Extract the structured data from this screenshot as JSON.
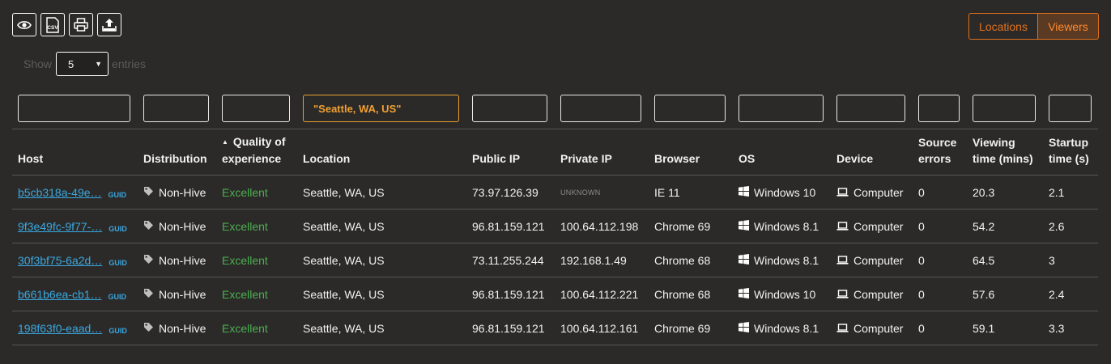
{
  "toolbar": {
    "view_icon": "eye-icon",
    "csv_icon": "csv-icon",
    "csv_label": "CSV",
    "print_icon": "printer-icon",
    "export_icon": "upload-icon"
  },
  "tabs": {
    "locations": "Locations",
    "viewers": "Viewers",
    "active": "Viewers"
  },
  "length": {
    "show": "Show",
    "value": "5",
    "entries": "entries"
  },
  "filters": {
    "host": "",
    "distribution": "",
    "quality": "",
    "location": "\"Seattle, WA, US\"",
    "public_ip": "",
    "private_ip": "",
    "browser": "",
    "os": "",
    "device": "",
    "source_errors": "",
    "viewing_time": "",
    "startup_time": ""
  },
  "columns": {
    "host": "Host",
    "distribution": "Distribution",
    "quality_1": "Quality of",
    "quality_2": "experience",
    "location": "Location",
    "public_ip": "Public IP",
    "private_ip": "Private IP",
    "browser": "Browser",
    "os": "OS",
    "device": "Device",
    "source_errors_1": "Source",
    "source_errors_2": "errors",
    "viewing_time_1": "Viewing",
    "viewing_time_2": "time (mins)",
    "startup_time_1": "Startup",
    "startup_time_2": "time (s)"
  },
  "guid_label": "GUID",
  "colors": {
    "accent": "#e0711d",
    "link": "#3aa8e0",
    "excellent": "#4caf50",
    "filter_active": "#e8a030"
  },
  "rows": [
    {
      "host": "b5cb318a-49e…",
      "distribution": "Non-Hive",
      "quality": "Excellent",
      "location": "Seattle, WA, US",
      "public_ip": "73.97.126.39",
      "private_ip": "UNKNOWN",
      "browser": "IE 11",
      "os": "Windows 10",
      "device": "Computer",
      "source_errors": "0",
      "viewing_time": "20.3",
      "startup_time": "2.1"
    },
    {
      "host": "9f3e49fc-9f77-…",
      "distribution": "Non-Hive",
      "quality": "Excellent",
      "location": "Seattle, WA, US",
      "public_ip": "96.81.159.121",
      "private_ip": "100.64.112.198",
      "browser": "Chrome 69",
      "os": "Windows 8.1",
      "device": "Computer",
      "source_errors": "0",
      "viewing_time": "54.2",
      "startup_time": "2.6"
    },
    {
      "host": "30f3bf75-6a2d…",
      "distribution": "Non-Hive",
      "quality": "Excellent",
      "location": "Seattle, WA, US",
      "public_ip": "73.11.255.244",
      "private_ip": "192.168.1.49",
      "browser": "Chrome 68",
      "os": "Windows 8.1",
      "device": "Computer",
      "source_errors": "0",
      "viewing_time": "64.5",
      "startup_time": "3"
    },
    {
      "host": "b661b6ea-cb1…",
      "distribution": "Non-Hive",
      "quality": "Excellent",
      "location": "Seattle, WA, US",
      "public_ip": "96.81.159.121",
      "private_ip": "100.64.112.221",
      "browser": "Chrome 68",
      "os": "Windows 10",
      "device": "Computer",
      "source_errors": "0",
      "viewing_time": "57.6",
      "startup_time": "2.4"
    },
    {
      "host": "198f63f0-eaad…",
      "distribution": "Non-Hive",
      "quality": "Excellent",
      "location": "Seattle, WA, US",
      "public_ip": "96.81.159.121",
      "private_ip": "100.64.112.161",
      "browser": "Chrome 69",
      "os": "Windows 8.1",
      "device": "Computer",
      "source_errors": "0",
      "viewing_time": "59.1",
      "startup_time": "3.3"
    }
  ]
}
